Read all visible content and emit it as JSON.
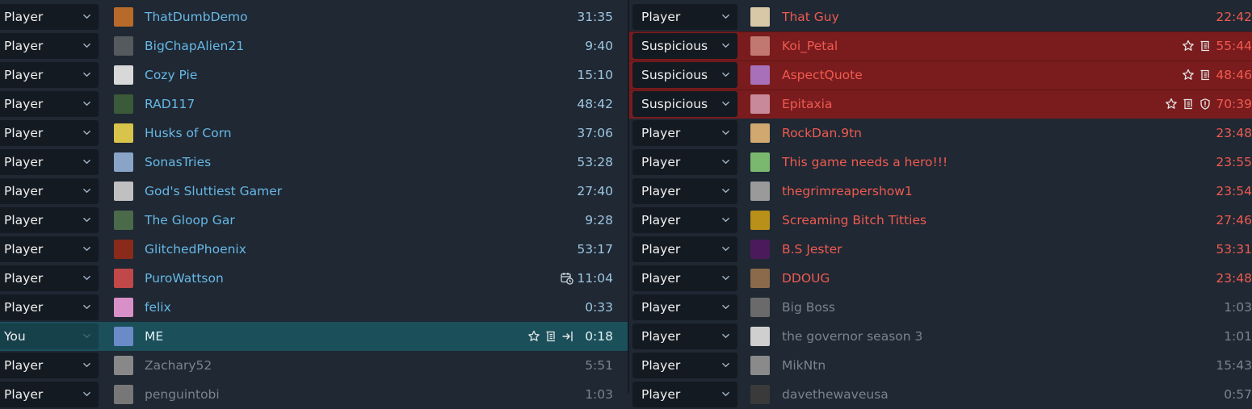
{
  "left_team": [
    {
      "role": "Player",
      "name": "ThatDumbDemo",
      "time": "31:35",
      "avatar": "#b86a2a",
      "state": "normal"
    },
    {
      "role": "Player",
      "name": "BigChapAlien21",
      "time": "9:40",
      "avatar": "#555a5e",
      "state": "normal"
    },
    {
      "role": "Player",
      "name": "Cozy Pie",
      "time": "15:10",
      "avatar": "#d8d8d8",
      "state": "normal"
    },
    {
      "role": "Player",
      "name": "RAD117",
      "time": "48:42",
      "avatar": "#3a5a3a",
      "state": "normal"
    },
    {
      "role": "Player",
      "name": "Husks of Corn",
      "time": "37:06",
      "avatar": "#d8c44a",
      "state": "normal"
    },
    {
      "role": "Player",
      "name": "SonasTries",
      "time": "53:28",
      "avatar": "#8aa4c8",
      "state": "normal"
    },
    {
      "role": "Player",
      "name": "God's Sluttiest Gamer",
      "time": "27:40",
      "avatar": "#c0c0c0",
      "state": "normal"
    },
    {
      "role": "Player",
      "name": "The Gloop Gar",
      "time": "9:28",
      "avatar": "#4a6a4a",
      "state": "normal"
    },
    {
      "role": "Player",
      "name": "GlitchedPhoenix",
      "time": "53:17",
      "avatar": "#8a2a1a",
      "state": "normal"
    },
    {
      "role": "Player",
      "name": "PuroWattson",
      "time": "11:04",
      "avatar": "#c04848",
      "state": "normal",
      "icons": [
        "scheduled-icon"
      ]
    },
    {
      "role": "Player",
      "name": "felix",
      "time": "0:33",
      "avatar": "#d890c8",
      "state": "normal"
    },
    {
      "role": "You",
      "name": "ME",
      "time": "0:18",
      "avatar": "#6a8ac8",
      "state": "you",
      "icons": [
        "star-icon",
        "scroll-icon",
        "join-icon"
      ]
    },
    {
      "role": "Player",
      "name": "Zachary52",
      "time": "5:51",
      "avatar": "#888",
      "state": "dim"
    },
    {
      "role": "Player",
      "name": "penguintobi",
      "time": "1:03",
      "avatar": "#777",
      "state": "dim"
    }
  ],
  "right_team": [
    {
      "role": "Player",
      "name": "That Guy",
      "time": "22:42",
      "avatar": "#d8c8a8",
      "state": "normal"
    },
    {
      "role": "Suspicious",
      "name": "Koi_Petal",
      "time": "55:44",
      "avatar": "#c07870",
      "state": "sus",
      "icons": [
        "star-icon",
        "scroll-icon"
      ]
    },
    {
      "role": "Suspicious",
      "name": "AspectQuote",
      "time": "48:46",
      "avatar": "#a870b8",
      "state": "sus",
      "icons": [
        "star-icon",
        "scroll-icon"
      ]
    },
    {
      "role": "Suspicious",
      "name": "Epitaxia",
      "time": "70:39",
      "avatar": "#c88a9a",
      "state": "sus",
      "icons": [
        "star-icon",
        "scroll-icon",
        "shield-icon"
      ]
    },
    {
      "role": "Player",
      "name": "RockDan.9tn",
      "time": "23:48",
      "avatar": "#d0a870",
      "state": "normal"
    },
    {
      "role": "Player",
      "name": "This game needs a hero!!!",
      "time": "23:55",
      "avatar": "#7ab870",
      "state": "normal"
    },
    {
      "role": "Player",
      "name": "thegrimreapershow1",
      "time": "23:54",
      "avatar": "#9a9a9a",
      "state": "normal"
    },
    {
      "role": "Player",
      "name": "Screaming Bitch Titties",
      "time": "27:46",
      "avatar": "#b8901a",
      "state": "normal"
    },
    {
      "role": "Player",
      "name": "B.S Jester",
      "time": "53:31",
      "avatar": "#4a1a5a",
      "state": "normal"
    },
    {
      "role": "Player",
      "name": "DDOUG",
      "time": "23:48",
      "avatar": "#8a6a4a",
      "state": "normal"
    },
    {
      "role": "Player",
      "name": "Big Boss",
      "time": "1:03",
      "avatar": "#6a6a6a",
      "state": "dim"
    },
    {
      "role": "Player",
      "name": "the governor season 3",
      "time": "1:01",
      "avatar": "#cfcfcf",
      "state": "dim"
    },
    {
      "role": "Player",
      "name": "MikNtn",
      "time": "15:43",
      "avatar": "#8a8a8a",
      "state": "dim"
    },
    {
      "role": "Player",
      "name": "davethewaveusa",
      "time": "0:57",
      "avatar": "#3a3a3a",
      "state": "dim"
    }
  ]
}
